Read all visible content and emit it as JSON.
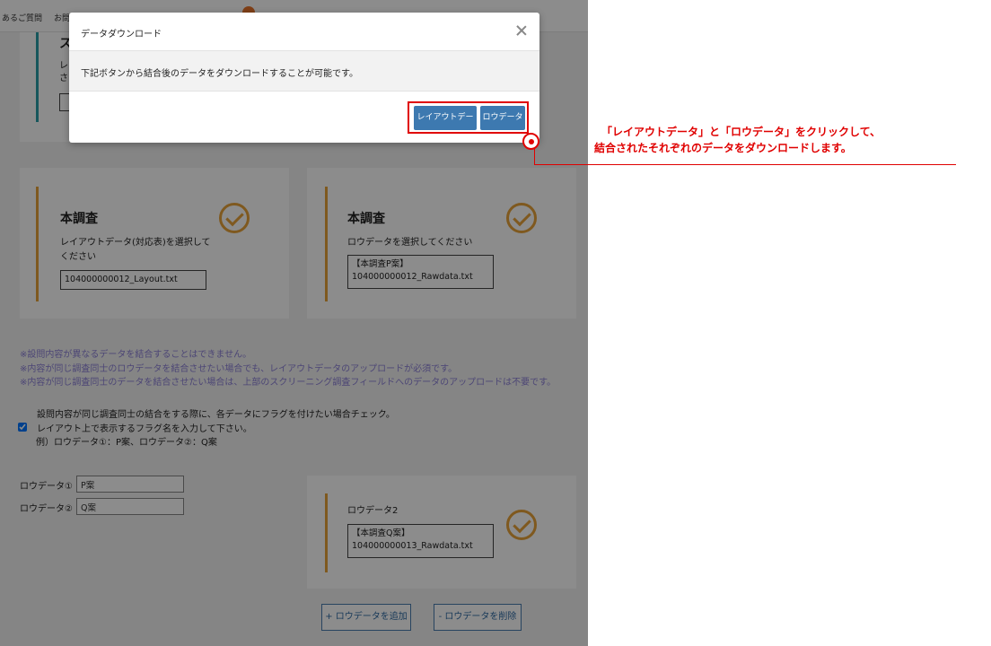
{
  "nav": {
    "item1": "あるご質問",
    "item2": "お問"
  },
  "top_card": {
    "title_fragment": "ス",
    "desc_line1": "レ",
    "desc_line2": "さ"
  },
  "card_layout": {
    "title": "本調査",
    "desc": "レイアウトデータ(対応表)を選択してください",
    "file": "104000000012_Layout.txt"
  },
  "card_raw": {
    "title": "本調査",
    "desc": "ロウデータを選択してください",
    "file_line1": "【本調査P案】",
    "file_line2": "104000000012_Rawdata.txt"
  },
  "notes": [
    "※設問内容が異なるデータを結合することはできません。",
    "※内容が同じ調査同士のロウデータを結合させたい場合でも、レイアウトデータのアップロードが必須です。",
    "※内容が同じ調査同士のデータを結合させたい場合は、上部のスクリーニング調査フィールドへのデータのアップロードは不要です。"
  ],
  "flag_option": {
    "line1": "設問内容が同じ調査同士の結合をする際に、各データにフラグを付けたい場合チェック。",
    "line2": "レイアウト上で表示するフラグ名を入力して下さい。",
    "line3": "例）ロウデータ①：P案、ロウデータ②：Q案",
    "checked": true
  },
  "raw_inputs": [
    {
      "label": "ロウデータ①",
      "value": "P案"
    },
    {
      "label": "ロウデータ②",
      "value": "Q案"
    }
  ],
  "card_raw2": {
    "title": "ロウデータ2",
    "file_line1": "【本調査Q案】",
    "file_line2": "104000000013_Rawdata.txt"
  },
  "buttons": {
    "add_raw": "+ ロウデータを追加",
    "remove_raw": "- ロウデータを削除"
  },
  "modal": {
    "title": "データダウンロード",
    "message": "下記ボタンから結合後のデータをダウンロードすることが可能です。",
    "layout_button": "レイアウトデータ",
    "raw_button": "ロウデータ"
  },
  "annotation": {
    "line1": "「レイアウトデータ」と「ロウデータ」をクリックして、",
    "line2": "結合されたそれぞれのデータをダウンロードします。",
    "color": "#e00000"
  },
  "colors": {
    "accent": "#e8a23a",
    "primary_button": "#3d79b0",
    "note_text": "#8a7fd6"
  }
}
